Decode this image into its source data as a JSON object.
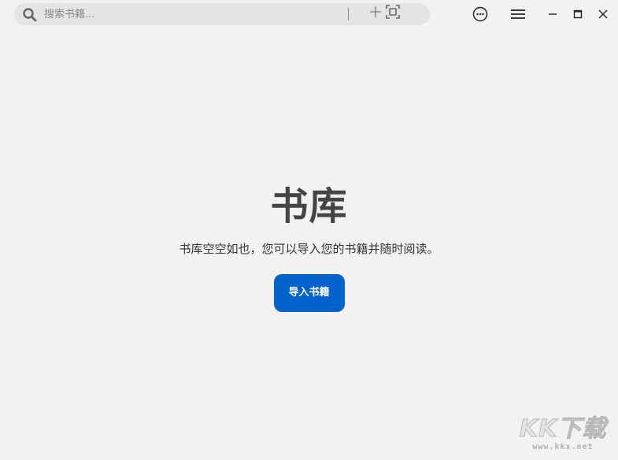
{
  "search": {
    "placeholder": "搜索书籍...",
    "value": ""
  },
  "toolbar": {
    "add_icon": "plus-icon",
    "scan_icon": "scan-frame-icon",
    "more_icon": "more-circle-icon",
    "menu_icon": "hamburger-menu-icon"
  },
  "window_controls": {
    "minimize_icon": "minimize-icon",
    "maximize_icon": "maximize-icon",
    "close_icon": "close-icon"
  },
  "main": {
    "title": "书库",
    "subtitle": "书库空空如也，您可以导入您的书籍并随时阅读。",
    "import_button": "导入书籍"
  },
  "watermark": {
    "logo": "KK下载",
    "url": "www.kkx.net"
  },
  "colors": {
    "background": "#f2f2f2",
    "search_bg": "#e4e4e4",
    "accent": "#0062cc",
    "title": "#444444"
  }
}
